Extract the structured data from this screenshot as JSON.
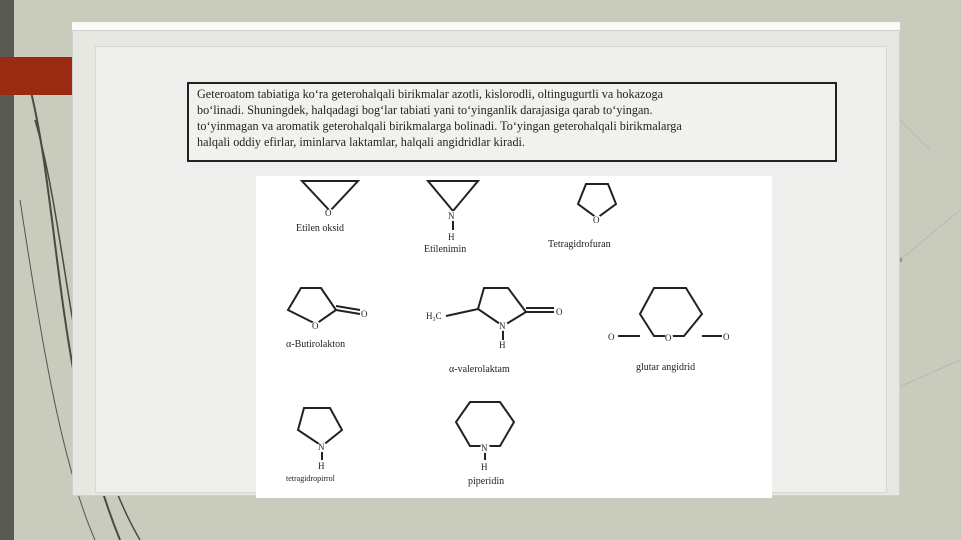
{
  "header": {
    "left_text": "",
    "right_text": ""
  },
  "paragraph": {
    "lines": [
      "Geteroatom tabiatiga ko‘ra geterohalqali birikmalar azotli, kislorodli, oltingugurtli va hokazoga",
      "bo‘linadi. Shuningdek, halqadagi bog‘lar tabiati yani to‘yinganlik darajasiga qarab to‘yingan.",
      "to‘yinmagan va aromatik geterohalqali birikmalarga bolinadi. To‘yingan geterohalqali birikmalarga",
      "halqali oddiy efirlar, iminlarva laktamlar, halqali angidridlar kiradi."
    ]
  },
  "structures": {
    "etilen_oksid": "Etilen oksid",
    "etilenimin": "Etilenimin",
    "tetragidrofuran": "Tetragidrofuran",
    "butirolakton": "α-Butirolakton",
    "valerolaktam": "α-valerolaktam",
    "glutar_angidrid": "glutar angidrid",
    "tetragidropirrol": "tetragidropirrol",
    "piperidin": "piperidin",
    "atoms": {
      "O": "O",
      "N": "N",
      "H": "H",
      "H3C": "H₃C"
    }
  },
  "colors": {
    "accent_red": "#9a2a12",
    "slide_bg": "#c9cbbd",
    "dark_bar": "#5a5a52"
  }
}
